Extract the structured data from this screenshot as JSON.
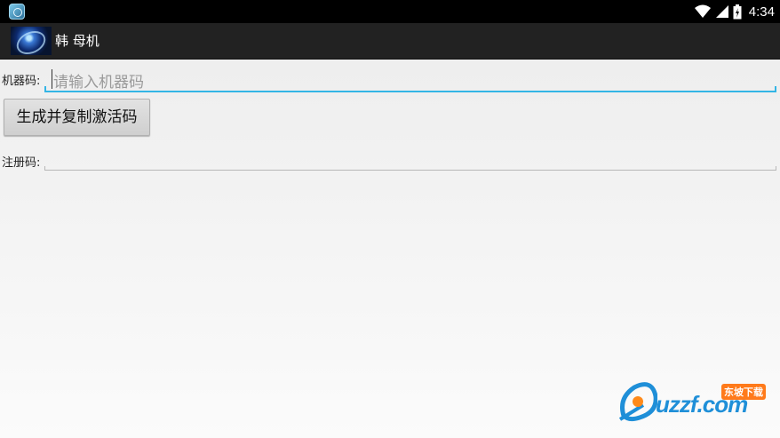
{
  "status_bar": {
    "time": "4:34"
  },
  "action_bar": {
    "title": "韩 母机"
  },
  "form": {
    "machine_code_label": "机器码:",
    "machine_code_placeholder": "请输入机器码",
    "generate_button_label": "生成并复制激活码",
    "register_code_label": "注册码:",
    "register_code_value": ""
  },
  "watermark": {
    "brand": "uzzf.com",
    "badge": "东坡下载"
  }
}
